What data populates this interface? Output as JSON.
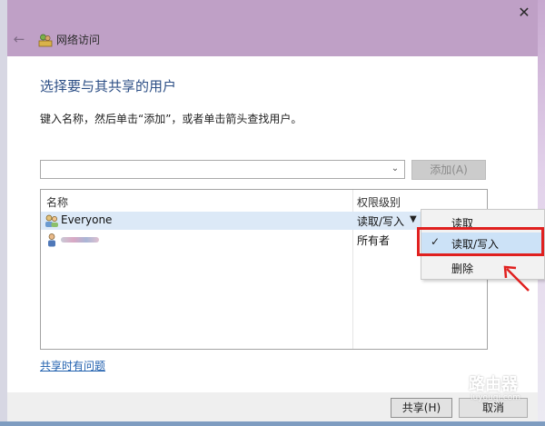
{
  "window": {
    "title": "网络访问",
    "close_glyph": "✕",
    "back_glyph": "←"
  },
  "main": {
    "heading": "选择要与其共享的用户",
    "instruction": "键入名称，然后单击“添加”，或者单击箭头查找用户。",
    "name_input_value": "",
    "add_button": "添加(A)"
  },
  "table": {
    "headers": [
      "名称",
      "权限级别"
    ],
    "rows": [
      {
        "name": "Everyone",
        "permission": "读取/写入",
        "selected": true
      },
      {
        "name": "",
        "permission": "所有者",
        "selected": false
      }
    ]
  },
  "menu": {
    "items": [
      {
        "label": "读取",
        "checked": false
      },
      {
        "label": "读取/写入",
        "checked": true
      },
      {
        "label": "删除",
        "checked": false
      }
    ]
  },
  "footer": {
    "help_link": "共享时有问题",
    "share_button": "共享(H)",
    "cancel_button": "取消"
  },
  "watermark": {
    "text": "路由器",
    "url": "luyouqi.com"
  },
  "colors": {
    "titlebar": "#bfa0c6",
    "heading": "#2d4f86",
    "link": "#1f5fae",
    "selection": "#dce9f7",
    "annotation_red": "#e0201f"
  }
}
